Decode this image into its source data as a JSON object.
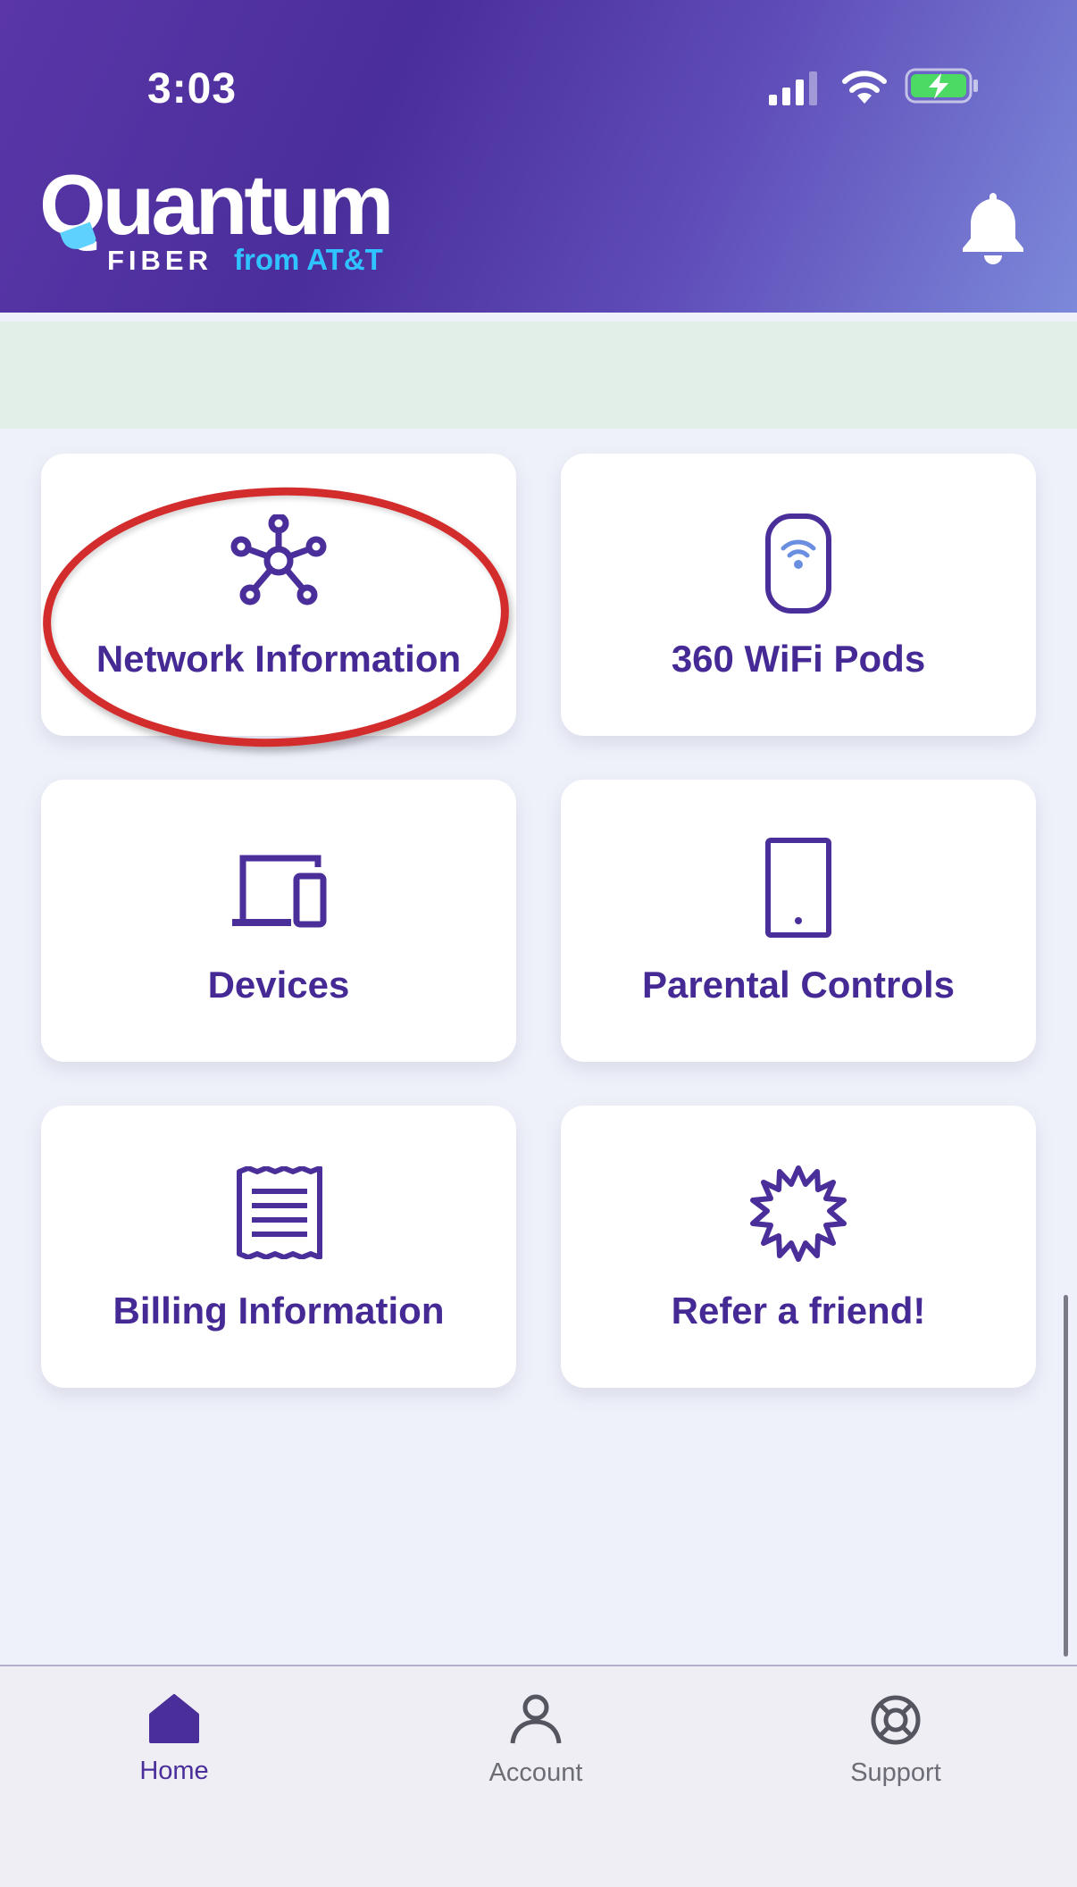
{
  "status_bar": {
    "time": "3:03",
    "icons": [
      "signal-icon",
      "wifi-icon",
      "battery-charging-icon"
    ]
  },
  "header": {
    "logo_main": "Quantum",
    "logo_fiber": "FIBER",
    "logo_from": "from AT&T",
    "bell_icon": "bell-icon"
  },
  "colors": {
    "accent": "#4a2e9a",
    "label": "#452a95",
    "highlight": "#d32c2c",
    "battery": "#4cd964",
    "att_blue": "#2fc3ff",
    "banner": "#e2efe9"
  },
  "tiles": [
    {
      "label": "Network Information",
      "icon": "network-hub-icon"
    },
    {
      "label": "360 WiFi Pods",
      "icon": "wifi-pod-icon"
    },
    {
      "label": "Devices",
      "icon": "devices-icon"
    },
    {
      "label": "Parental Controls",
      "icon": "tablet-icon"
    },
    {
      "label": "Billing Information",
      "icon": "receipt-icon"
    },
    {
      "label": "Refer a friend!",
      "icon": "starburst-icon"
    }
  ],
  "tabbar": {
    "items": [
      {
        "label": "Home",
        "icon": "home-icon",
        "active": true
      },
      {
        "label": "Account",
        "icon": "person-icon",
        "active": false
      },
      {
        "label": "Support",
        "icon": "lifebuoy-icon",
        "active": false
      }
    ]
  }
}
